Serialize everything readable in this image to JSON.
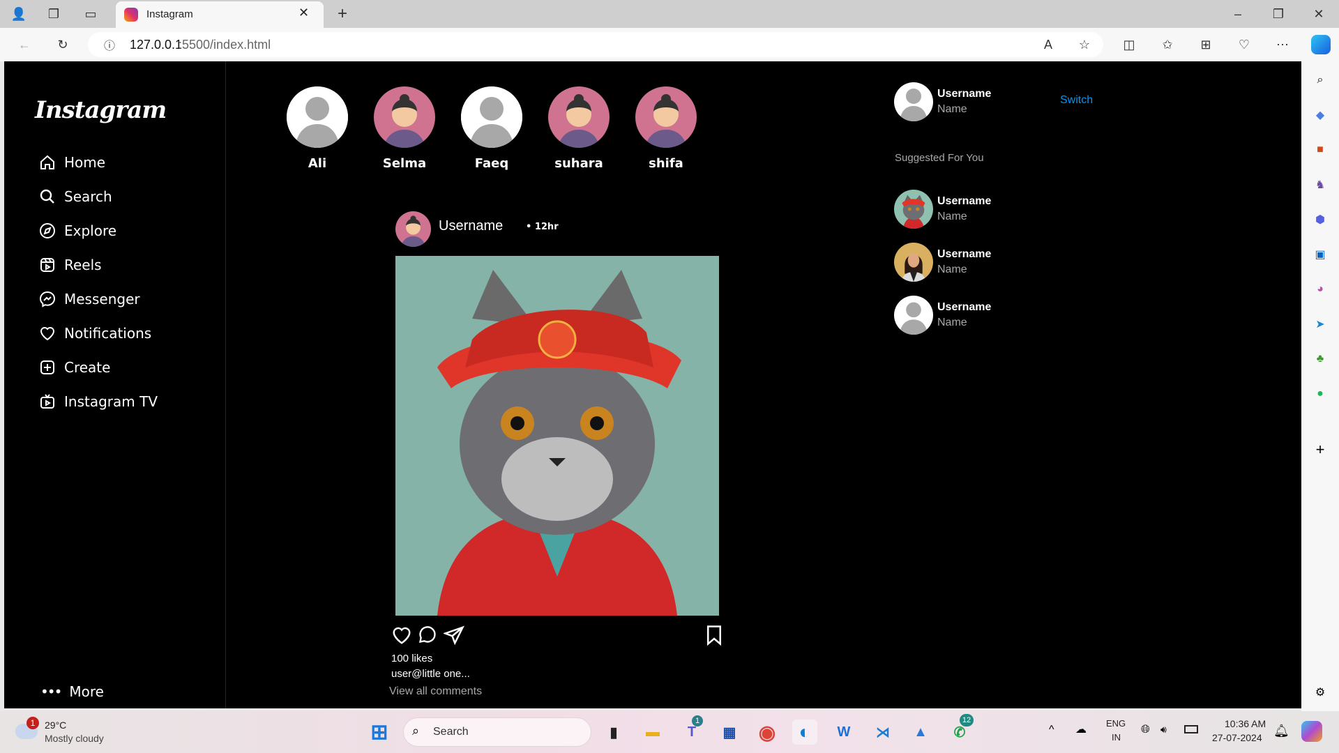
{
  "browser": {
    "tab_title": "Instagram",
    "url_host": "127.0.0.1",
    "url_rest": ":5500/index.html"
  },
  "nav": {
    "logo": "Instagram",
    "items": [
      {
        "label": "Home",
        "icon": "home-icon"
      },
      {
        "label": "Search",
        "icon": "search-icon"
      },
      {
        "label": "Explore",
        "icon": "compass-icon"
      },
      {
        "label": "Reels",
        "icon": "reels-icon"
      },
      {
        "label": "Messenger",
        "icon": "messenger-icon"
      },
      {
        "label": "Notifications",
        "icon": "heart-icon"
      },
      {
        "label": "Create",
        "icon": "plus-square-icon"
      },
      {
        "label": "Instagram TV",
        "icon": "tv-icon"
      }
    ],
    "more": "More"
  },
  "stories": [
    {
      "name": "Ali",
      "avatar": "default"
    },
    {
      "name": "Selma",
      "avatar": "female"
    },
    {
      "name": "Faeq",
      "avatar": "default"
    },
    {
      "name": "suhara",
      "avatar": "female"
    },
    {
      "name": "shifa",
      "avatar": "female"
    }
  ],
  "post": {
    "username": "Username",
    "time": "12hr",
    "likes": "100 likes",
    "caption": "user@little one...",
    "view_comments": "View all comments"
  },
  "profile": {
    "username": "Username",
    "name": "Name",
    "switch": "Switch"
  },
  "suggested": {
    "title": "Suggested For You",
    "items": [
      {
        "username": "Username",
        "name": "Name",
        "avatar": "cat"
      },
      {
        "username": "Username",
        "name": "Name",
        "avatar": "woman"
      },
      {
        "username": "Username",
        "name": "Name",
        "avatar": "default"
      }
    ]
  },
  "taskbar": {
    "temp": "29°C",
    "weather": "Mostly cloudy",
    "weather_badge": "1",
    "search": "Search",
    "teams_badge": "1",
    "whatsapp_badge": "12",
    "lang1": "ENG",
    "lang2": "IN",
    "time": "10:36 AM",
    "date": "27-07-2024"
  },
  "colors": {
    "accent": "#0095f6",
    "story_pink": "#cf7390"
  }
}
